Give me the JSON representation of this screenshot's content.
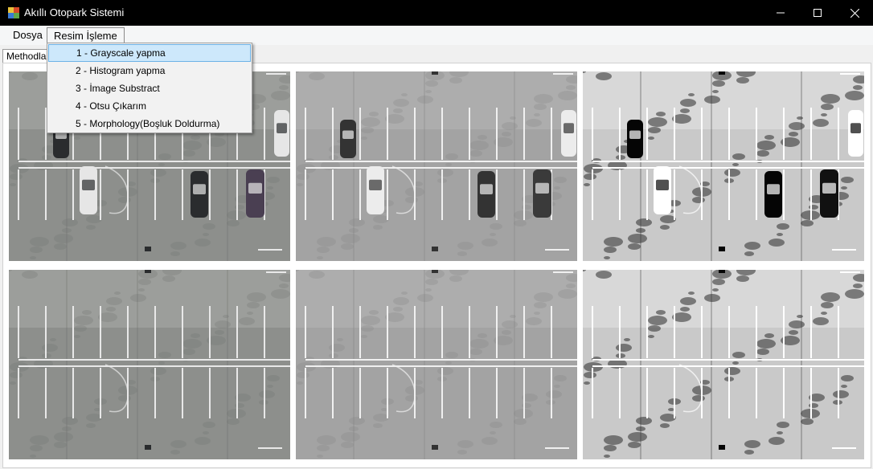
{
  "window": {
    "title": "Akıllı Otopark Sistemi",
    "app_icon": "windows-forms-app-icon",
    "controls": [
      "minimize-icon",
      "maximize-icon",
      "close-icon"
    ]
  },
  "menubar": {
    "items": [
      {
        "label": "Dosya"
      },
      {
        "label": "Resim İşleme",
        "open": true
      }
    ]
  },
  "tab": {
    "label": "Methodlar"
  },
  "dropdown": {
    "items": [
      {
        "label": "1 - Grayscale yapma",
        "highlighted": true
      },
      {
        "label": "2 - Histogram yapma"
      },
      {
        "label": "3 - İmage Substract"
      },
      {
        "label": "4 - Otsu Çıkarım"
      },
      {
        "label": "5 - Morphology(Boşluk Doldurma)"
      }
    ]
  },
  "images": [
    {
      "name": "original-image",
      "tone": "color",
      "cars": true
    },
    {
      "name": "grayscale-image",
      "tone": "gray",
      "cars": true
    },
    {
      "name": "histogram-image",
      "tone": "contrast",
      "cars": true
    },
    {
      "name": "empty-lot-original-image",
      "tone": "color",
      "cars": false
    },
    {
      "name": "empty-lot-grayscale-image",
      "tone": "gray",
      "cars": false
    },
    {
      "name": "empty-lot-histogram-image",
      "tone": "contrast",
      "cars": false
    }
  ],
  "colors": {
    "titlebar": "#000000",
    "menubar": "#f5f6f7",
    "highlight": "#cde8fb",
    "highlight_border": "#6cb2e6"
  }
}
